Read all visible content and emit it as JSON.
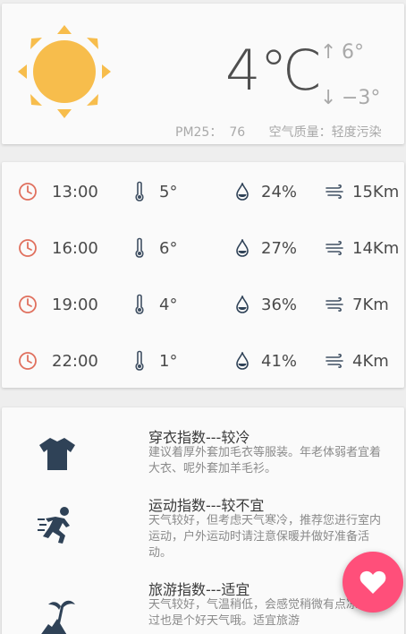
{
  "current": {
    "temperature": "4℃",
    "high": "6°",
    "low": "−3°",
    "pm25_label": "PM25：",
    "pm25_value": "76",
    "air_quality_label": "空气质量：",
    "air_quality_value": "轻度污染",
    "icon": "sun-icon"
  },
  "hourly": [
    {
      "time": "13:00",
      "temp": "5°",
      "humidity": "24%",
      "wind": "15Km"
    },
    {
      "time": "16:00",
      "temp": "6°",
      "humidity": "27%",
      "wind": "14Km"
    },
    {
      "time": "19:00",
      "temp": "4°",
      "humidity": "36%",
      "wind": "7Km"
    },
    {
      "time": "22:00",
      "temp": "1°",
      "humidity": "41%",
      "wind": "4Km"
    }
  ],
  "life_index": [
    {
      "title": "穿衣指数---较冷",
      "desc": "建议着厚外套加毛衣等服装。年老体弱者宜着大衣、呢外套加羊毛衫。",
      "icon": "tshirt-icon"
    },
    {
      "title": "运动指数---较不宜",
      "desc": "天气较好，但考虑天气寒冷，推荐您进行室内运动，户外运动时请注意保暖并做好准备活动。",
      "icon": "runner-icon"
    },
    {
      "title": "旅游指数---适宜",
      "desc": "天气较好，气温稍低，会感觉稍微有点凉，不过也是个好天气哦。适宜旅游",
      "icon": "island-icon"
    }
  ],
  "colors": {
    "accent_clock": "#e0705e",
    "sun": "#f7bd4c",
    "fab": "#ff4f7a",
    "icon_dark": "#2f4257"
  },
  "fab_icon": "heart-icon"
}
